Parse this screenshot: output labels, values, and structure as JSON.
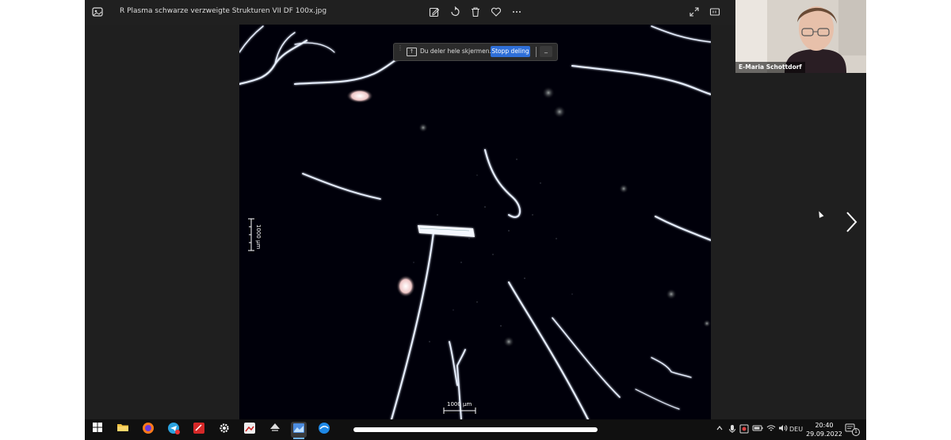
{
  "window": {
    "title": "R Plasma schwarze verzweigte Strukturen VII DF 100x.jpg"
  },
  "toolbar": {
    "icons": [
      "edit-image-icon",
      "rotate-icon",
      "delete-icon",
      "favorite-icon",
      "more-icon",
      "fullscreen-icon",
      "actual-size-icon"
    ]
  },
  "photo": {
    "scale_bar_vertical": "1000 µm",
    "scale_bar_horizontal": "1000 µm"
  },
  "share_banner": {
    "text": "Du deler hele skjermen.",
    "stop_label": "Stopp deling",
    "minimize_label": "_"
  },
  "webcam": {
    "name": "E-Maria Schottdorf"
  },
  "taskbar": {
    "apps": [
      "windows-start-icon",
      "file-explorer-icon",
      "firefox-icon",
      "telegram-icon",
      "zoom-red-icon",
      "settings-icon",
      "photo-app-icon",
      "inkscape-icon",
      "photos-icon",
      "browser-icon"
    ],
    "tray": {
      "language": "DEU",
      "time": "20:40",
      "date": "29.09.2022",
      "notifications": "1"
    }
  },
  "colors": {
    "accent": "#2f6fd8",
    "background": "#1f1f1f",
    "taskbar": "#101010"
  }
}
